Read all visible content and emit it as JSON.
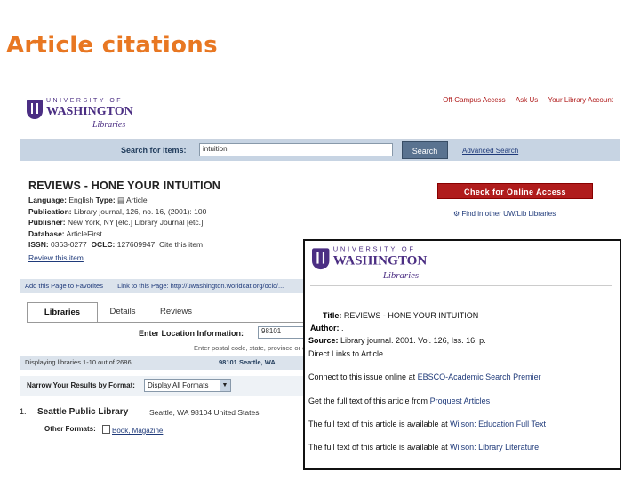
{
  "slide": {
    "title": "Article citations"
  },
  "logo": {
    "university": "UNIVERSITY OF",
    "washington": "WASHINGTON",
    "libraries": "Libraries"
  },
  "top_links": [
    "Off-Campus Access",
    "Ask Us",
    "Your Library Account"
  ],
  "search": {
    "label": "Search for items:",
    "value": "intuition",
    "button": "Search",
    "advanced": "Advanced Search"
  },
  "record": {
    "title": "REVIEWS - HONE YOUR INTUITION",
    "language_label": "Language:",
    "language_value": "English",
    "type_label": "Type:",
    "type_value": "Article",
    "publication_label": "Publication:",
    "publication_value": "Library journal, 126, no. 16, (2001): 100",
    "publisher_label": "Publisher:",
    "publisher_value": "New York, NY [etc.] Library Journal [etc.]",
    "database_label": "Database:",
    "database_value": "ArticleFirst",
    "issn_label": "ISSN:",
    "issn_value": "0363-0277",
    "oclc_label": "OCLC:",
    "oclc_value": "127609947",
    "cite_label": "Cite this item",
    "review_link": "Review this item"
  },
  "check_online": "Check for Online Access",
  "find_other": "Find in other UW/Lib Libraries",
  "toolbar": [
    "Add this Page to Favorites",
    "Link to this Page: http://uwashington.worldcat.org/oclc/..."
  ],
  "tabs": [
    "Libraries",
    "Details",
    "Reviews"
  ],
  "location": {
    "label": "Enter Location Information:",
    "value": "98101",
    "hint": "Enter postal code, state, province or country"
  },
  "display": {
    "left": "Displaying libraries 1-10 out of 2686",
    "right": "98101 Seattle, WA"
  },
  "narrow": {
    "label": "Narrow Your Results by Format:",
    "selected": "Display All Formats"
  },
  "library": {
    "num": "1.",
    "name": "Seattle Public Library",
    "address": "Seattle, WA 98104 United States",
    "other_label": "Other Formats:",
    "other_format": "Book, Magazine"
  },
  "popup": {
    "title_label": "Title:",
    "title_value": "REVIEWS - HONE YOUR INTUITION",
    "author_label": "Author:",
    "author_value": ".",
    "source_label": "Source:",
    "source_value": "Library journal. 2001. Vol. 126, Iss. 16; p. ",
    "direct": "Direct Links to Article",
    "link1_pre": "Connect to this issue online at ",
    "link1": "EBSCO-Academic Search Premier",
    "link2_pre": "Get the full text of this article from ",
    "link2": "Proquest Articles",
    "link3_pre": "The full text of this article is available at ",
    "link3": "Wilson: Education Full Text",
    "link4_pre": "The full text of this article is available at ",
    "link4": "Wilson: Library Literature"
  }
}
